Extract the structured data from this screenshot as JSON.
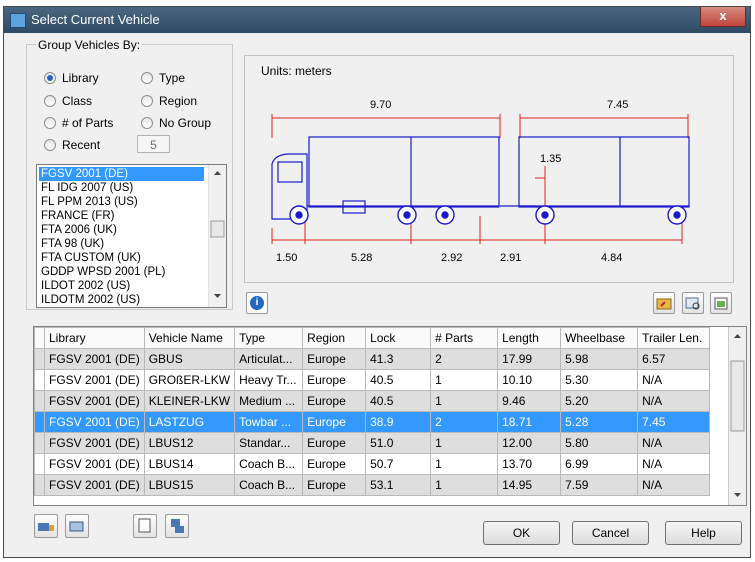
{
  "window": {
    "title": "Select Current Vehicle",
    "close_glyph": "x"
  },
  "group_by": {
    "title": "Group Vehicles By:",
    "options": [
      {
        "label": "Library",
        "checked": true
      },
      {
        "label": "Type",
        "checked": false
      },
      {
        "label": "Class",
        "checked": false
      },
      {
        "label": "Region",
        "checked": false
      },
      {
        "label": "# of Parts",
        "checked": false
      },
      {
        "label": "No Group",
        "checked": false
      },
      {
        "label": "Recent",
        "checked": false
      }
    ],
    "recent_count": "5"
  },
  "library_list": {
    "items": [
      "FGSV 2001 (DE)",
      "FL IDG 2007 (US)",
      "FL PPM 2013 (US)",
      "FRANCE (FR)",
      "FTA 2006 (UK)",
      "FTA 98 (UK)",
      "FTA CUSTOM (UK)",
      "GDDP WPSD 2001 (PL)",
      "ILDOT 2002 (US)",
      "ILDOTM 2002 (US)"
    ],
    "selected_index": 0
  },
  "preview": {
    "units_label": "Units:  meters",
    "dims_top": [
      "9.70",
      "7.45"
    ],
    "dim_hitch": "1.35",
    "dims_bottom": [
      "1.50",
      "5.28",
      "2.92",
      "2.91",
      "4.84"
    ]
  },
  "icons": {
    "info": "info-icon",
    "folder": "folder-open-icon",
    "preview": "vehicle-preview-icon",
    "export": "export-icon"
  },
  "table": {
    "columns": [
      "",
      "Library",
      "Vehicle Name",
      "Type",
      "Region",
      "Lock",
      "# Parts",
      "Length",
      "Wheelbase",
      "Trailer Len."
    ],
    "rows": [
      [
        "",
        "FGSV 2001 (DE)",
        "GBUS",
        "Articulat...",
        "Europe",
        "41.3",
        "2",
        "17.99",
        "5.98",
        "6.57"
      ],
      [
        "",
        "FGSV 2001 (DE)",
        "GROßER-LKW",
        "Heavy Tr...",
        "Europe",
        "40.5",
        "1",
        "10.10",
        "5.30",
        "N/A"
      ],
      [
        "",
        "FGSV 2001 (DE)",
        "KLEINER-LKW",
        "Medium ...",
        "Europe",
        "40.5",
        "1",
        "9.46",
        "5.20",
        "N/A"
      ],
      [
        "",
        "FGSV 2001 (DE)",
        "LASTZUG",
        "Towbar ...",
        "Europe",
        "38.9",
        "2",
        "18.71",
        "5.28",
        "7.45"
      ],
      [
        "",
        "FGSV 2001 (DE)",
        "LBUS12",
        "Standar...",
        "Europe",
        "51.0",
        "1",
        "12.00",
        "5.80",
        "N/A"
      ],
      [
        "",
        "FGSV 2001 (DE)",
        "LBUS14",
        "Coach B...",
        "Europe",
        "50.7",
        "1",
        "13.70",
        "6.99",
        "N/A"
      ],
      [
        "",
        "FGSV 2001 (DE)",
        "LBUS15",
        "Coach B...",
        "Europe",
        "53.1",
        "1",
        "14.95",
        "7.59",
        "N/A"
      ]
    ],
    "selected_row": 3
  },
  "buttons": {
    "ok": "OK",
    "cancel": "Cancel",
    "help": "Help"
  }
}
